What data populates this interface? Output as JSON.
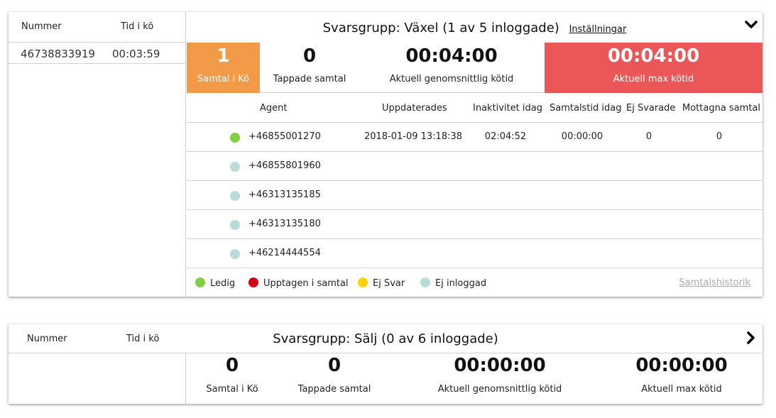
{
  "colors": {
    "orange": "#f29a48",
    "red": "#eb5757",
    "green": "#7fd142",
    "busy_red": "#d4001a",
    "yellow": "#ffd200",
    "light_blue": "#b9dcdb"
  },
  "groups": [
    {
      "expanded": true,
      "toggle_icon": "chevron-down-icon",
      "left": {
        "col_number": "Nummer",
        "col_time": "Tid i kö",
        "queue": [
          {
            "number": "46738833919",
            "time": "00:03:59"
          }
        ]
      },
      "title": "Svarsgrupp: Växel (1 av 5 inloggade)",
      "settings_label": "Inställningar",
      "stats": [
        {
          "value": "1",
          "label": "Samtal i Kö"
        },
        {
          "value": "0",
          "label": "Tappade samtal"
        },
        {
          "value": "00:04:00",
          "label": "Aktuell genomsnittlig kötid"
        },
        {
          "value": "00:04:00",
          "label": "Aktuell max kötid"
        }
      ],
      "table_headers": [
        "Agent",
        "Uppdaterades",
        "Inaktivitet idag",
        "Samtalstid idag",
        "Ej Svarade",
        "Mottagna samtal"
      ],
      "agents": [
        {
          "number": "+46855001270",
          "status": "green",
          "updated": "2018-01-09 13:18:38",
          "inactivity": "02:04:52",
          "talk_time": "00:00:00",
          "missed": "0",
          "received": "0"
        },
        {
          "number": "+46855801960",
          "status": "light_blue"
        },
        {
          "number": "+46313135185",
          "status": "light_blue"
        },
        {
          "number": "+46313135180",
          "status": "light_blue"
        },
        {
          "number": "+46214444554",
          "status": "light_blue"
        }
      ],
      "legend": [
        {
          "label": "Ledig",
          "color": "green"
        },
        {
          "label": "Upptagen i samtal",
          "color": "busy_red"
        },
        {
          "label": "Ej Svar",
          "color": "yellow"
        },
        {
          "label": "Ej inloggad",
          "color": "light_blue"
        }
      ],
      "history_label": "Samtalshistorik"
    },
    {
      "expanded": false,
      "toggle_icon": "chevron-right-icon",
      "left": {
        "col_number": "Nummer",
        "col_time": "Tid i kö"
      },
      "title": "Svarsgrupp: Sälj (0 av 6 inloggade)",
      "stats": [
        {
          "value": "0",
          "label": "Samtal i Kö"
        },
        {
          "value": "0",
          "label": "Tappade samtal"
        },
        {
          "value": "00:00:00",
          "label": "Aktuell genomsnittlig kötid"
        },
        {
          "value": "00:00:00",
          "label": "Aktuell max kötid"
        }
      ]
    }
  ]
}
